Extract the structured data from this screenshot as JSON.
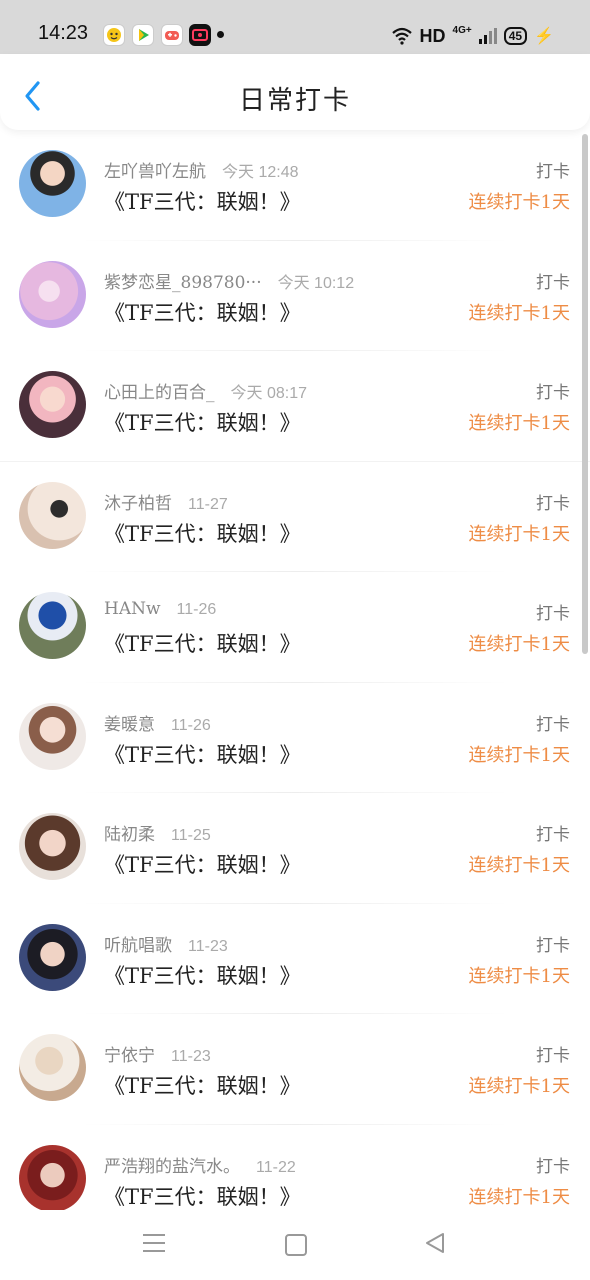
{
  "status_bar": {
    "time": "14:23",
    "network": "HD",
    "signal": "4G+",
    "battery": "45",
    "icons": [
      "face-app-icon",
      "green-play-icon",
      "game-app-icon",
      "tv-app-icon",
      "notification-dot-icon",
      "wifi-icon",
      "signal-bars-icon",
      "battery-icon",
      "charging-bolt-icon"
    ]
  },
  "header": {
    "title": "日常打卡",
    "back_icon": "chevron-left-icon"
  },
  "colors": {
    "accent": "#ee8c45",
    "back": "#2196f3",
    "statusbar": "#d9d9d9"
  },
  "records": [
    {
      "user": "左吖兽吖左航",
      "time": "今天 12:48",
      "book": "《TF三代：联姻！》",
      "action": "打卡",
      "streak": "连续打卡1天",
      "avatar": "avatar-photo-1"
    },
    {
      "user": "紫梦恋星_898780···",
      "time": "今天 10:12",
      "book": "《TF三代：联姻！》",
      "action": "打卡",
      "streak": "连续打卡1天",
      "avatar": "avatar-photo-2"
    },
    {
      "user": "心田上的百合_",
      "time": "今天 08:17",
      "book": "《TF三代：联姻！》",
      "action": "打卡",
      "streak": "连续打卡1天",
      "avatar": "avatar-photo-3"
    },
    {
      "user": "沐子柏哲",
      "time": "11-27",
      "book": "《TF三代：联姻！》",
      "action": "打卡",
      "streak": "连续打卡1天",
      "avatar": "avatar-photo-4"
    },
    {
      "user": "HANw",
      "time": "11-26",
      "book": "《TF三代：联姻！》",
      "action": "打卡",
      "streak": "连续打卡1天",
      "avatar": "avatar-photo-5"
    },
    {
      "user": "姜暖意",
      "time": "11-26",
      "book": "《TF三代：联姻！》",
      "action": "打卡",
      "streak": "连续打卡1天",
      "avatar": "avatar-photo-6"
    },
    {
      "user": "陆初柔",
      "time": "11-25",
      "book": "《TF三代：联姻！》",
      "action": "打卡",
      "streak": "连续打卡1天",
      "avatar": "avatar-photo-7"
    },
    {
      "user": "听航唱歌",
      "time": "11-23",
      "book": "《TF三代：联姻！》",
      "action": "打卡",
      "streak": "连续打卡1天",
      "avatar": "avatar-photo-8"
    },
    {
      "user": "宁依宁",
      "time": "11-23",
      "book": "《TF三代：联姻！》",
      "action": "打卡",
      "streak": "连续打卡1天",
      "avatar": "avatar-photo-9"
    },
    {
      "user": "严浩翔的盐汽水。",
      "time": "11-22",
      "book": "《TF三代：联姻！》",
      "action": "打卡",
      "streak": "连续打卡1天",
      "avatar": "avatar-photo-10"
    }
  ],
  "nav_bar": {
    "icons": [
      "menu-icon",
      "home-square-icon",
      "back-triangle-icon"
    ]
  }
}
